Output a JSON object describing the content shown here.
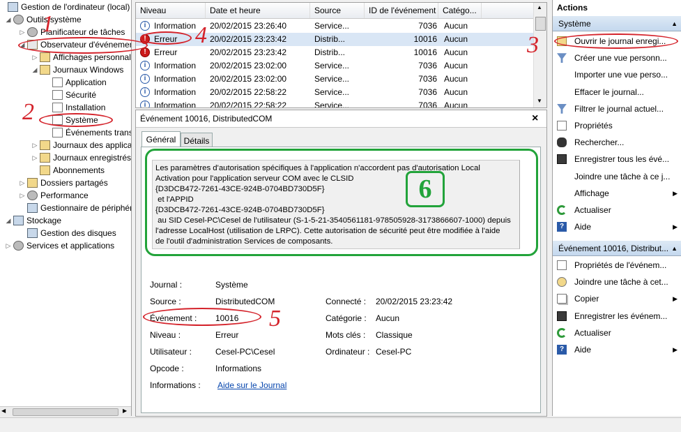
{
  "tree": {
    "items": [
      {
        "label": "Gestion de l'ordinateur (local)",
        "twisty": "",
        "icon": "computer-icon",
        "depth": 0
      },
      {
        "label": "Outils système",
        "twisty": "◢",
        "icon": "tools-icon",
        "depth": 1
      },
      {
        "label": "Planificateur de tâches",
        "twisty": "▷",
        "icon": "clock-icon",
        "depth": 2
      },
      {
        "label": "Observateur d'événements",
        "twisty": "◢",
        "icon": "event-viewer-icon",
        "depth": 2
      },
      {
        "label": "Affichages personnalisés",
        "twisty": "▷",
        "icon": "folder-icon",
        "depth": 3
      },
      {
        "label": "Journaux Windows",
        "twisty": "◢",
        "icon": "folder-icon",
        "depth": 3
      },
      {
        "label": "Application",
        "twisty": "",
        "icon": "log-icon",
        "depth": 4
      },
      {
        "label": "Sécurité",
        "twisty": "",
        "icon": "log-icon",
        "depth": 4
      },
      {
        "label": "Installation",
        "twisty": "",
        "icon": "log-icon",
        "depth": 4
      },
      {
        "label": "Système",
        "twisty": "",
        "icon": "log-icon",
        "depth": 4
      },
      {
        "label": "Événements transférés",
        "twisty": "",
        "icon": "log-icon",
        "depth": 4
      },
      {
        "label": "Journaux des applications et des services",
        "twisty": "▷",
        "icon": "folder-icon",
        "depth": 3
      },
      {
        "label": "Journaux enregistrés",
        "twisty": "▷",
        "icon": "folder-icon",
        "depth": 3
      },
      {
        "label": "Abonnements",
        "twisty": "",
        "icon": "subscriptions-icon",
        "depth": 3
      },
      {
        "label": "Dossiers partagés",
        "twisty": "▷",
        "icon": "shared-folder-icon",
        "depth": 2
      },
      {
        "label": "Performance",
        "twisty": "▷",
        "icon": "performance-icon",
        "depth": 2
      },
      {
        "label": "Gestionnaire de périphériques",
        "twisty": "",
        "icon": "device-manager-icon",
        "depth": 2
      },
      {
        "label": "Stockage",
        "twisty": "◢",
        "icon": "storage-icon",
        "depth": 1
      },
      {
        "label": "Gestion des disques",
        "twisty": "",
        "icon": "disk-icon",
        "depth": 2
      },
      {
        "label": "Services et applications",
        "twisty": "▷",
        "icon": "services-icon",
        "depth": 1
      }
    ]
  },
  "event_list": {
    "columns": [
      "Niveau",
      "Date et heure",
      "Source",
      "ID de l'événement",
      "Catégo..."
    ],
    "rows": [
      {
        "level": "Information",
        "type": "info",
        "date": "20/02/2015 23:26:40",
        "source": "Service...",
        "id": "7036",
        "category": "Aucun"
      },
      {
        "level": "Erreur",
        "type": "err",
        "date": "20/02/2015 23:23:42",
        "source": "Distrib...",
        "id": "10016",
        "category": "Aucun"
      },
      {
        "level": "Erreur",
        "type": "err",
        "date": "20/02/2015 23:23:42",
        "source": "Distrib...",
        "id": "10016",
        "category": "Aucun"
      },
      {
        "level": "Information",
        "type": "info",
        "date": "20/02/2015 23:02:00",
        "source": "Service...",
        "id": "7036",
        "category": "Aucun"
      },
      {
        "level": "Information",
        "type": "info",
        "date": "20/02/2015 23:02:00",
        "source": "Service...",
        "id": "7036",
        "category": "Aucun"
      },
      {
        "level": "Information",
        "type": "info",
        "date": "20/02/2015 22:58:22",
        "source": "Service...",
        "id": "7036",
        "category": "Aucun"
      },
      {
        "level": "Information",
        "type": "info",
        "date": "20/02/2015 22:58:22",
        "source": "Service...",
        "id": "7036",
        "category": "Aucun"
      }
    ]
  },
  "detail": {
    "title": "Événement 10016, DistributedCOM",
    "close": "×",
    "tabs": [
      "Général",
      "Détails"
    ],
    "description": [
      "Les paramètres d'autorisation spécifiques à l'application n'accordent pas d'autorisation Local",
      "Activation pour l'application serveur COM avec le CLSID",
      "{D3DCB472-7261-43CE-924B-0704BD730D5F}",
      " et l'APPID",
      "{D3DCB472-7261-43CE-924B-0704BD730D5F}",
      " au SID Cesel-PC\\Cesel de l'utilisateur (S-1-5-21-3540561181-978505928-3173866607-1000) depuis",
      "l'adresse LocalHost (utilisation de LRPC). Cette autorisation de sécurité peut être modifiée à l'aide",
      "de l'outil d'administration Services de composants."
    ],
    "fields": {
      "journal_label": "Journal :",
      "journal": "Système",
      "source_label": "Source :",
      "source": "DistributedCOM",
      "event_label": "Événement :",
      "event": "10016",
      "level_label": "Niveau :",
      "level": "Erreur",
      "user_label": "Utilisateur :",
      "user": "Cesel-PC\\Cesel",
      "opcode_label": "Opcode :",
      "opcode": "Informations",
      "info_label": "Informations :",
      "info_link": "Aide sur le Journal",
      "logged_label": "Connecté :",
      "logged": "20/02/2015 23:23:42",
      "category_label": "Catégorie :",
      "category": "Aucun",
      "keywords_label": "Mots clés :",
      "keywords": "Classique",
      "computer_label": "Ordinateur :",
      "computer": "Cesel-PC"
    }
  },
  "actions": {
    "header": "Actions",
    "section1": "Système",
    "items1": [
      {
        "label": "Ouvrir le journal enregi...",
        "icon": "open-folder-icon",
        "arrow": ""
      },
      {
        "label": "Créer une vue personn...",
        "icon": "filter-icon",
        "arrow": ""
      },
      {
        "label": "Importer une vue perso...",
        "icon": "",
        "arrow": ""
      },
      {
        "label": "Effacer le journal...",
        "icon": "",
        "arrow": ""
      },
      {
        "label": "Filtrer le journal actuel...",
        "icon": "filter-icon",
        "arrow": ""
      },
      {
        "label": "Propriétés",
        "icon": "properties-icon",
        "arrow": ""
      },
      {
        "label": "Rechercher...",
        "icon": "binoculars-icon",
        "arrow": ""
      },
      {
        "label": "Enregistrer tous les évé...",
        "icon": "save-icon",
        "arrow": ""
      },
      {
        "label": "Joindre une tâche à ce j...",
        "icon": "",
        "arrow": ""
      },
      {
        "label": "Affichage",
        "icon": "",
        "arrow": "▶"
      },
      {
        "label": "Actualiser",
        "icon": "refresh-icon",
        "arrow": ""
      },
      {
        "label": "Aide",
        "icon": "help-icon",
        "arrow": "▶"
      }
    ],
    "section2": "Événement 10016, Distribut...",
    "items2": [
      {
        "label": "Propriétés de l'événem...",
        "icon": "properties-icon",
        "arrow": ""
      },
      {
        "label": "Joindre une tâche à cet...",
        "icon": "task-icon",
        "arrow": ""
      },
      {
        "label": "Copier",
        "icon": "copy-icon",
        "arrow": "▶"
      },
      {
        "label": "Enregistrer les événem...",
        "icon": "save-icon",
        "arrow": ""
      },
      {
        "label": "Actualiser",
        "icon": "refresh-icon",
        "arrow": ""
      },
      {
        "label": "Aide",
        "icon": "help-icon",
        "arrow": "▶"
      }
    ]
  },
  "annotations": [
    "1",
    "2",
    "3",
    "4",
    "5",
    "6"
  ],
  "colors": {
    "annotation_red": "#d4232b",
    "annotation_green": "#22a33a",
    "selection": "#d9e6f5",
    "link": "#0645ad"
  }
}
